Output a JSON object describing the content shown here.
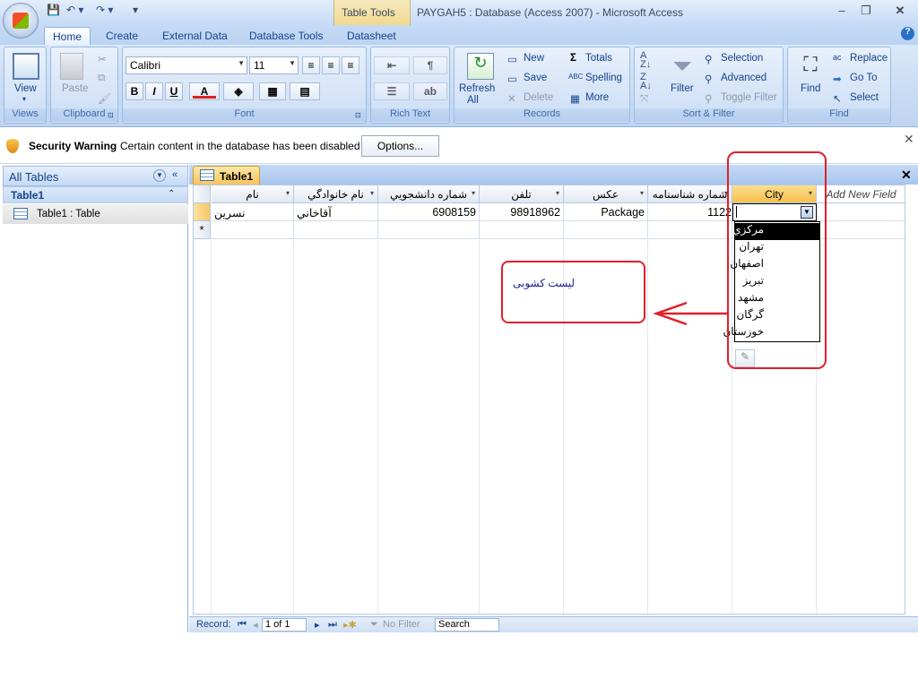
{
  "window": {
    "title": "PAYGAH5 : Database (Access 2007)  -  Microsoft Access",
    "contextual_tab": "Table Tools"
  },
  "tabs": [
    {
      "label": "Home",
      "active": true
    },
    {
      "label": "Create"
    },
    {
      "label": "External Data"
    },
    {
      "label": "Database Tools"
    },
    {
      "label": "Datasheet"
    }
  ],
  "ribbon": {
    "views": {
      "group": "Views",
      "view_label": "View"
    },
    "clipboard": {
      "group": "Clipboard",
      "paste_label": "Paste"
    },
    "font": {
      "group": "Font",
      "font_name": "Calibri",
      "font_size": "11",
      "bold": "B",
      "italic": "I",
      "underline": "U"
    },
    "rich_text": {
      "group": "Rich Text"
    },
    "records": {
      "group": "Records",
      "refresh_label": "Refresh",
      "refresh_sub": "All",
      "new": "New",
      "save": "Save",
      "delete": "Delete",
      "totals": "Totals",
      "spelling": "Spelling",
      "more": "More"
    },
    "sort_filter": {
      "group": "Sort & Filter",
      "filter": "Filter",
      "selection": "Selection",
      "advanced": "Advanced",
      "toggle_filter": "Toggle Filter"
    },
    "find": {
      "group": "Find",
      "find": "Find",
      "replace": "Replace",
      "goto": "Go To",
      "select": "Select"
    }
  },
  "security": {
    "title": "Security Warning",
    "message": "Certain content in the database has been disabled",
    "options_label": "Options..."
  },
  "nav": {
    "header": "All Tables",
    "group": "Table1",
    "item": "Table1 : Table"
  },
  "document": {
    "tab": "Table1"
  },
  "grid": {
    "columns": [
      "نام",
      "نام خانوادگي",
      "شماره دانشجويي",
      "تلفن",
      "عکس",
      "شماره شناسنامه",
      "City",
      "Add New Field"
    ],
    "row": [
      "نسرين",
      "آقاخاني",
      "6908159",
      "98918962",
      "Package",
      "1122",
      ""
    ],
    "new_row_marker": "*"
  },
  "dropdown": {
    "options": [
      "مرکزي",
      "تهران",
      "اصفهان",
      "تبريز",
      "مشهد",
      "گرگان",
      "خوزستان"
    ],
    "highlighted": 0
  },
  "annotation": {
    "text": "لیست کشوبی"
  },
  "status": {
    "record_label": "Record:",
    "record_value": "1 of 1",
    "filter_label": "No Filter",
    "search_label": "Search"
  }
}
